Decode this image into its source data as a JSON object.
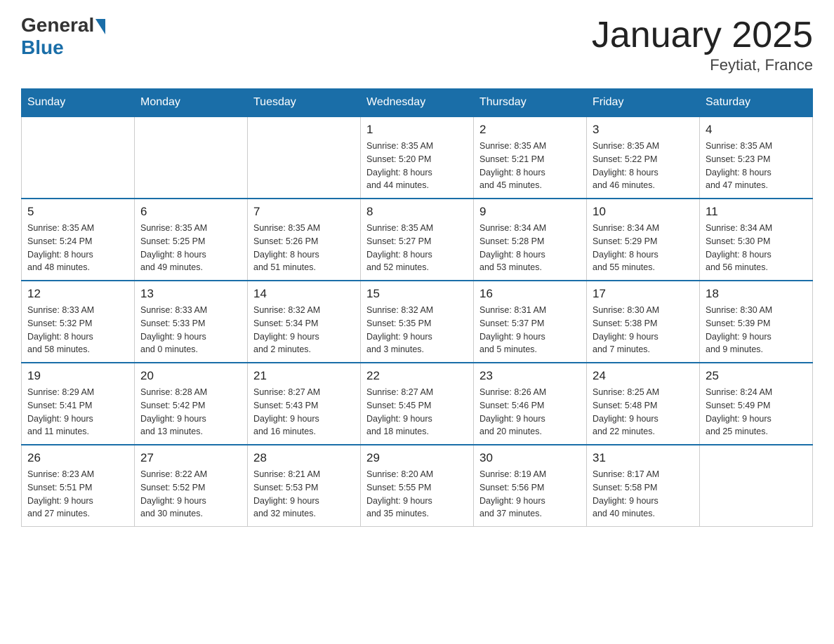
{
  "header": {
    "logo_general": "General",
    "logo_blue": "Blue",
    "title": "January 2025",
    "subtitle": "Feytiat, France"
  },
  "days_of_week": [
    "Sunday",
    "Monday",
    "Tuesday",
    "Wednesday",
    "Thursday",
    "Friday",
    "Saturday"
  ],
  "weeks": [
    {
      "days": [
        {
          "num": "",
          "info": ""
        },
        {
          "num": "",
          "info": ""
        },
        {
          "num": "",
          "info": ""
        },
        {
          "num": "1",
          "info": "Sunrise: 8:35 AM\nSunset: 5:20 PM\nDaylight: 8 hours\nand 44 minutes."
        },
        {
          "num": "2",
          "info": "Sunrise: 8:35 AM\nSunset: 5:21 PM\nDaylight: 8 hours\nand 45 minutes."
        },
        {
          "num": "3",
          "info": "Sunrise: 8:35 AM\nSunset: 5:22 PM\nDaylight: 8 hours\nand 46 minutes."
        },
        {
          "num": "4",
          "info": "Sunrise: 8:35 AM\nSunset: 5:23 PM\nDaylight: 8 hours\nand 47 minutes."
        }
      ]
    },
    {
      "days": [
        {
          "num": "5",
          "info": "Sunrise: 8:35 AM\nSunset: 5:24 PM\nDaylight: 8 hours\nand 48 minutes."
        },
        {
          "num": "6",
          "info": "Sunrise: 8:35 AM\nSunset: 5:25 PM\nDaylight: 8 hours\nand 49 minutes."
        },
        {
          "num": "7",
          "info": "Sunrise: 8:35 AM\nSunset: 5:26 PM\nDaylight: 8 hours\nand 51 minutes."
        },
        {
          "num": "8",
          "info": "Sunrise: 8:35 AM\nSunset: 5:27 PM\nDaylight: 8 hours\nand 52 minutes."
        },
        {
          "num": "9",
          "info": "Sunrise: 8:34 AM\nSunset: 5:28 PM\nDaylight: 8 hours\nand 53 minutes."
        },
        {
          "num": "10",
          "info": "Sunrise: 8:34 AM\nSunset: 5:29 PM\nDaylight: 8 hours\nand 55 minutes."
        },
        {
          "num": "11",
          "info": "Sunrise: 8:34 AM\nSunset: 5:30 PM\nDaylight: 8 hours\nand 56 minutes."
        }
      ]
    },
    {
      "days": [
        {
          "num": "12",
          "info": "Sunrise: 8:33 AM\nSunset: 5:32 PM\nDaylight: 8 hours\nand 58 minutes."
        },
        {
          "num": "13",
          "info": "Sunrise: 8:33 AM\nSunset: 5:33 PM\nDaylight: 9 hours\nand 0 minutes."
        },
        {
          "num": "14",
          "info": "Sunrise: 8:32 AM\nSunset: 5:34 PM\nDaylight: 9 hours\nand 2 minutes."
        },
        {
          "num": "15",
          "info": "Sunrise: 8:32 AM\nSunset: 5:35 PM\nDaylight: 9 hours\nand 3 minutes."
        },
        {
          "num": "16",
          "info": "Sunrise: 8:31 AM\nSunset: 5:37 PM\nDaylight: 9 hours\nand 5 minutes."
        },
        {
          "num": "17",
          "info": "Sunrise: 8:30 AM\nSunset: 5:38 PM\nDaylight: 9 hours\nand 7 minutes."
        },
        {
          "num": "18",
          "info": "Sunrise: 8:30 AM\nSunset: 5:39 PM\nDaylight: 9 hours\nand 9 minutes."
        }
      ]
    },
    {
      "days": [
        {
          "num": "19",
          "info": "Sunrise: 8:29 AM\nSunset: 5:41 PM\nDaylight: 9 hours\nand 11 minutes."
        },
        {
          "num": "20",
          "info": "Sunrise: 8:28 AM\nSunset: 5:42 PM\nDaylight: 9 hours\nand 13 minutes."
        },
        {
          "num": "21",
          "info": "Sunrise: 8:27 AM\nSunset: 5:43 PM\nDaylight: 9 hours\nand 16 minutes."
        },
        {
          "num": "22",
          "info": "Sunrise: 8:27 AM\nSunset: 5:45 PM\nDaylight: 9 hours\nand 18 minutes."
        },
        {
          "num": "23",
          "info": "Sunrise: 8:26 AM\nSunset: 5:46 PM\nDaylight: 9 hours\nand 20 minutes."
        },
        {
          "num": "24",
          "info": "Sunrise: 8:25 AM\nSunset: 5:48 PM\nDaylight: 9 hours\nand 22 minutes."
        },
        {
          "num": "25",
          "info": "Sunrise: 8:24 AM\nSunset: 5:49 PM\nDaylight: 9 hours\nand 25 minutes."
        }
      ]
    },
    {
      "days": [
        {
          "num": "26",
          "info": "Sunrise: 8:23 AM\nSunset: 5:51 PM\nDaylight: 9 hours\nand 27 minutes."
        },
        {
          "num": "27",
          "info": "Sunrise: 8:22 AM\nSunset: 5:52 PM\nDaylight: 9 hours\nand 30 minutes."
        },
        {
          "num": "28",
          "info": "Sunrise: 8:21 AM\nSunset: 5:53 PM\nDaylight: 9 hours\nand 32 minutes."
        },
        {
          "num": "29",
          "info": "Sunrise: 8:20 AM\nSunset: 5:55 PM\nDaylight: 9 hours\nand 35 minutes."
        },
        {
          "num": "30",
          "info": "Sunrise: 8:19 AM\nSunset: 5:56 PM\nDaylight: 9 hours\nand 37 minutes."
        },
        {
          "num": "31",
          "info": "Sunrise: 8:17 AM\nSunset: 5:58 PM\nDaylight: 9 hours\nand 40 minutes."
        },
        {
          "num": "",
          "info": ""
        }
      ]
    }
  ]
}
